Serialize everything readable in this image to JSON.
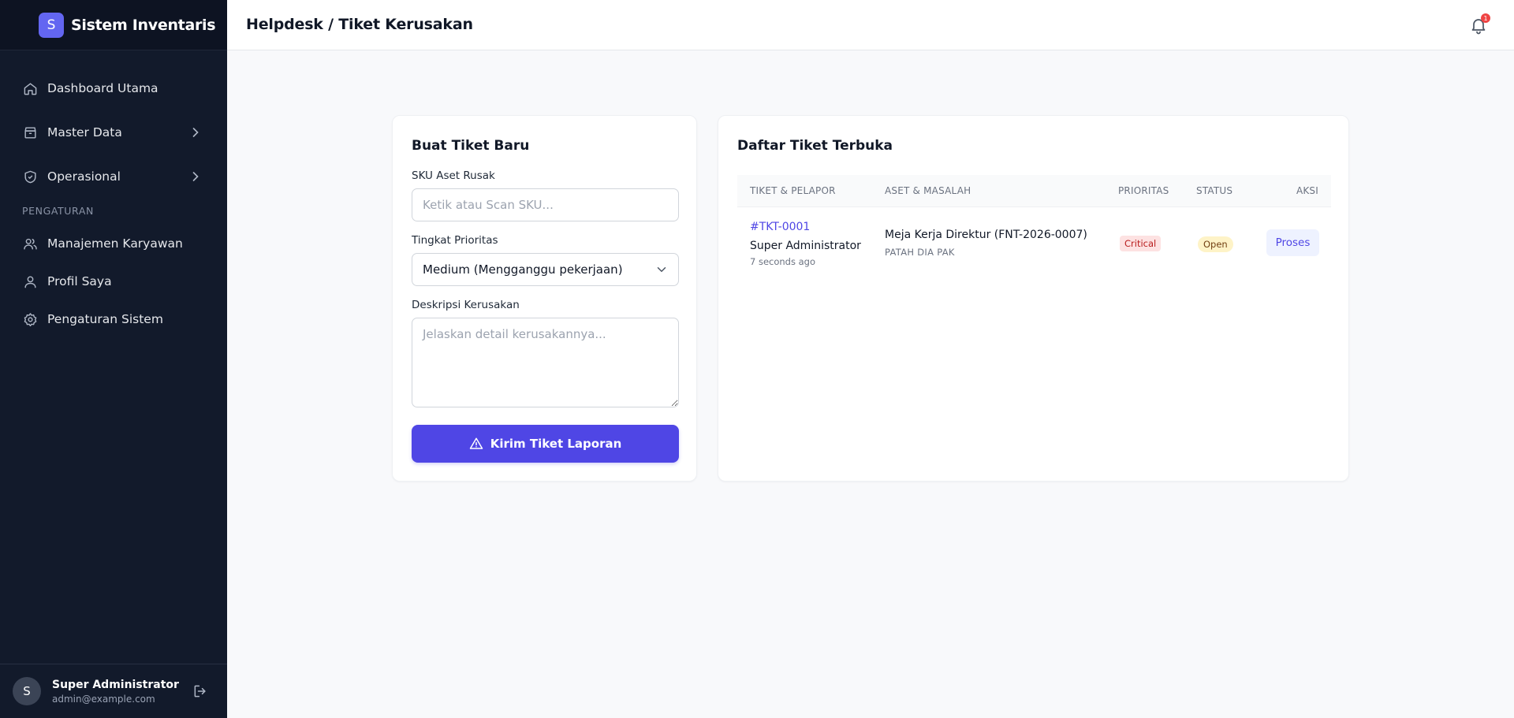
{
  "app": {
    "logo_letter": "S",
    "name": "Sistem Inventaris"
  },
  "sidebar": {
    "items": [
      {
        "label": "Dashboard Utama",
        "icon": "home-icon"
      },
      {
        "label": "Master Data",
        "icon": "archive-icon",
        "has_submenu": true
      },
      {
        "label": "Operasional",
        "icon": "shield-check-icon",
        "has_submenu": true
      }
    ],
    "section_label": "PENGATURAN",
    "settings_items": [
      {
        "label": "Manajemen Karyawan",
        "icon": "users-icon"
      },
      {
        "label": "Profil Saya",
        "icon": "user-icon"
      },
      {
        "label": "Pengaturan Sistem",
        "icon": "gear-icon"
      }
    ],
    "user": {
      "initial": "S",
      "name": "Super Administrator",
      "email": "admin@example.com"
    }
  },
  "header": {
    "title": "Helpdesk / Tiket Kerusakan",
    "notification_count": "1"
  },
  "form": {
    "title": "Buat Tiket Baru",
    "sku_label": "SKU Aset Rusak",
    "sku_placeholder": "Ketik atau Scan SKU...",
    "priority_label": "Tingkat Prioritas",
    "priority_value": "Medium (Mengganggu pekerjaan)",
    "description_label": "Deskripsi Kerusakan",
    "description_placeholder": "Jelaskan detail kerusakannya...",
    "submit_label": "Kirim Tiket Laporan"
  },
  "ticket_list": {
    "title": "Daftar Tiket Terbuka",
    "columns": [
      "TIKET & PELAPOR",
      "ASET & MASALAH",
      "PRIORITAS",
      "STATUS",
      "AKSI"
    ],
    "rows": [
      {
        "id": "#TKT-0001",
        "reporter": "Super Administrator",
        "time": "7 seconds ago",
        "asset": "Meja Kerja Direktur (FNT-2026-0007)",
        "problem": "PATAH DIA PAK",
        "priority": "Critical",
        "status": "Open",
        "action": "Proses"
      }
    ]
  },
  "colors": {
    "accent": "#4f46e5",
    "sidebar_bg": "#121a2b",
    "critical": "#b91c1c",
    "open": "#fef3c7"
  }
}
